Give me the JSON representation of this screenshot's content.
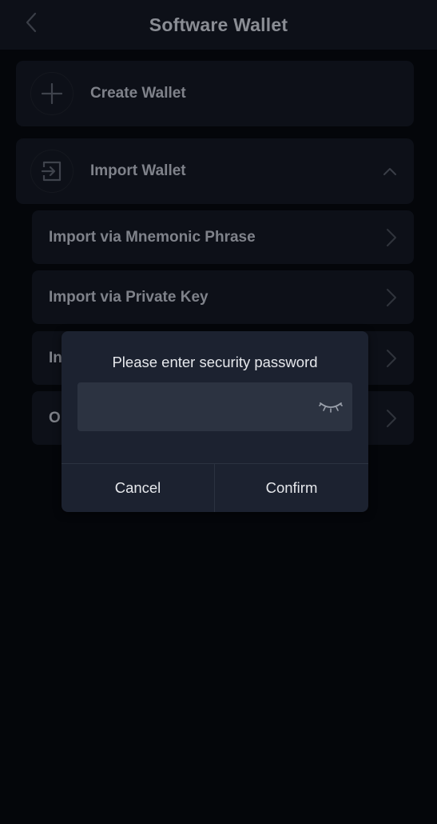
{
  "header": {
    "title": "Software Wallet",
    "back_icon": "chevron-left-icon"
  },
  "menu": {
    "create_wallet": {
      "label": "Create Wallet",
      "icon": "plus-icon"
    },
    "import_wallet": {
      "label": "Import Wallet",
      "icon": "import-arrow-icon",
      "expanded": true,
      "toggle_icon": "chevron-up-icon"
    },
    "import_options": [
      {
        "label": "Import via Mnemonic Phrase",
        "icon": "chevron-right-icon"
      },
      {
        "label": "Import via Private Key",
        "icon": "chevron-right-icon"
      },
      {
        "label": "In",
        "icon": "chevron-right-icon"
      },
      {
        "label": "O",
        "icon": "chevron-right-icon"
      }
    ]
  },
  "dialog": {
    "title": "Please enter security password",
    "password_value": "",
    "password_placeholder": "",
    "visibility_icon": "eye-closed-icon",
    "cancel_label": "Cancel",
    "confirm_label": "Confirm"
  },
  "colors": {
    "background": "#04060a",
    "surface": "#0d1018",
    "dialog": "#1c2230",
    "input": "#2c3341",
    "muted_text": "#7f828a",
    "dialog_text": "#e6e8ec"
  }
}
